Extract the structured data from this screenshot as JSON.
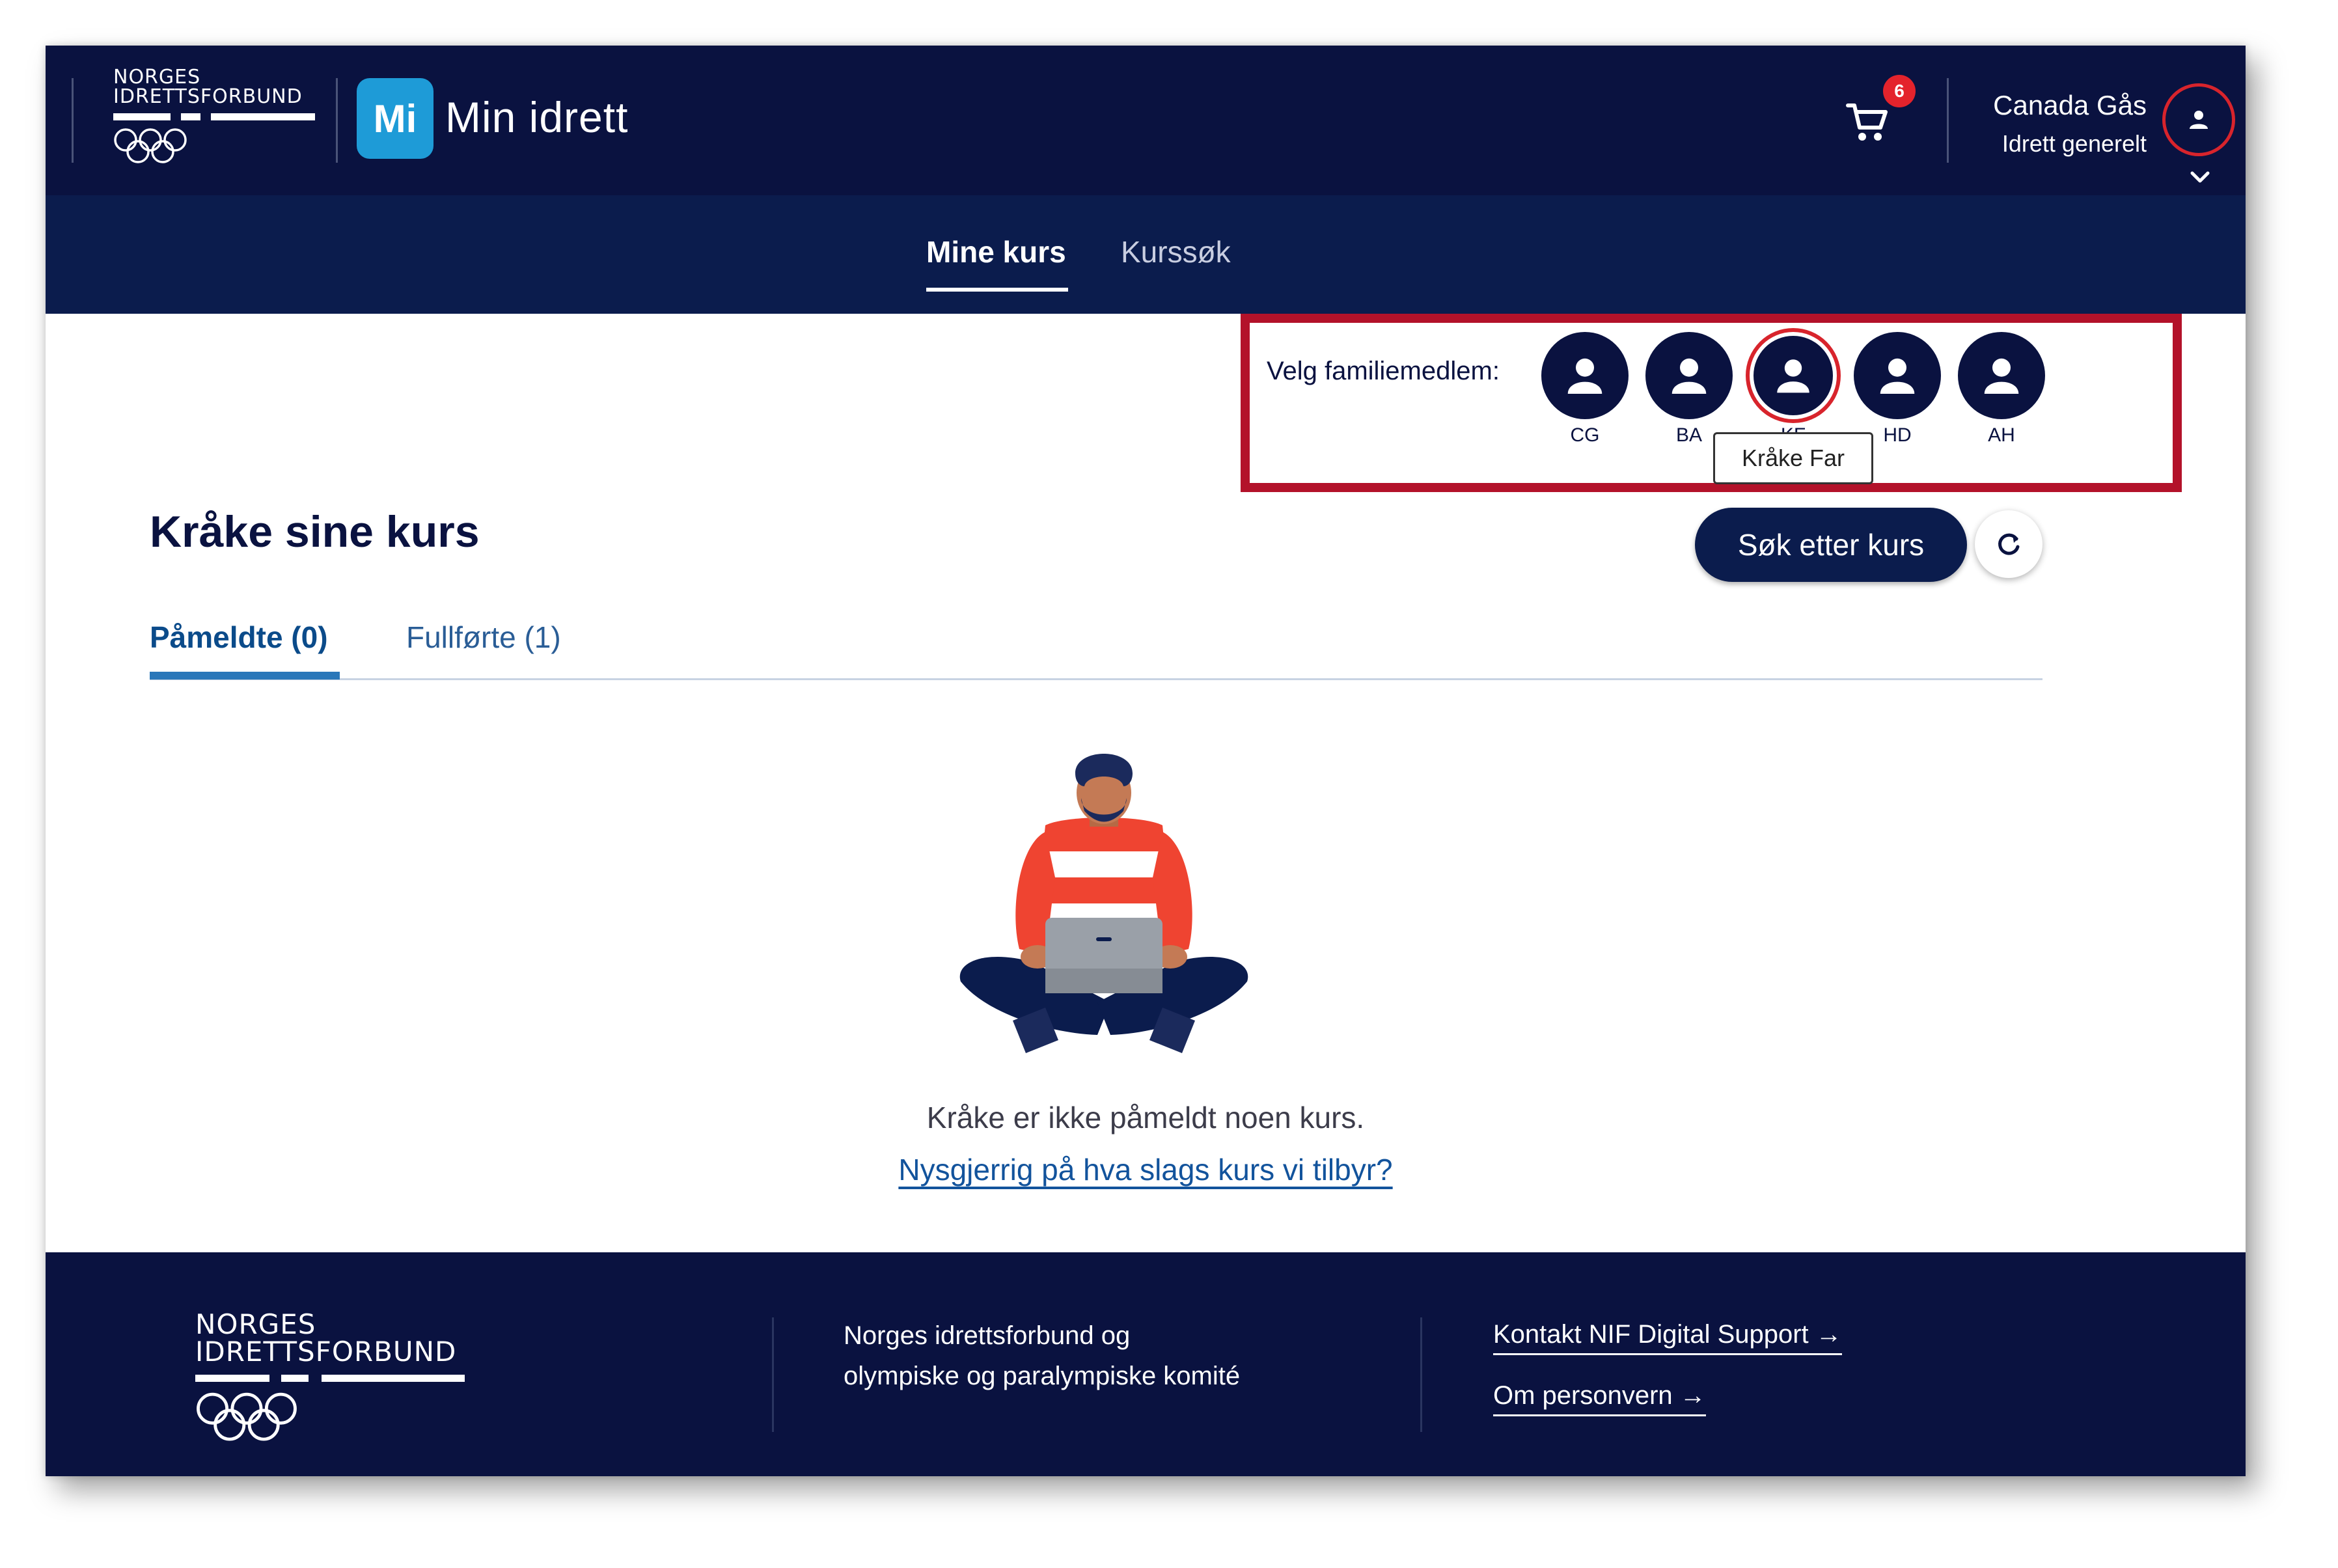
{
  "header": {
    "org_line1": "NORGES",
    "org_line2": "IDRETTSFORBUND",
    "app_badge": "Mi",
    "app_title": "Min idrett",
    "cart_count": "6",
    "user_name": "Canada Gås",
    "user_org": "Idrett generelt",
    "icons": [
      "olympic-rings-icon",
      "cart-icon",
      "user-icon",
      "chevron-down-icon"
    ]
  },
  "nav": {
    "tabs": [
      {
        "label": "Mine kurs",
        "active": true
      },
      {
        "label": "Kurssøk",
        "active": false
      }
    ]
  },
  "family": {
    "label": "Velg familiemedlem:",
    "members": [
      {
        "code": "CG",
        "selected": false
      },
      {
        "code": "BA",
        "selected": false
      },
      {
        "code": "KF",
        "selected": true
      },
      {
        "code": "HD",
        "selected": false
      },
      {
        "code": "AH",
        "selected": false
      }
    ],
    "tooltip": "Kråke Far"
  },
  "main": {
    "title": "Kråke sine kurs",
    "search_button": "Søk etter kurs",
    "refresh_icon": "refresh-icon",
    "tabs": [
      {
        "label": "Påmeldte (0)",
        "active": true
      },
      {
        "label": "Fullførte (1)",
        "active": false
      }
    ],
    "empty_text": "Kråke er ikke påmeldt noen kurs.",
    "empty_link": "Nysgjerrig på hva slags kurs vi tilbyr?"
  },
  "footer": {
    "org_line1": "NORGES",
    "org_line2": "IDRETTSFORBUND",
    "description_line1": "Norges idrettsforbund og",
    "description_line2": "olympiske og paralympiske komité",
    "links": [
      "Kontakt NIF Digital Support →",
      "Om personvern →"
    ]
  },
  "colors": {
    "header_bg": "#0a1240",
    "nav_bg": "#0b1c4d",
    "accent_blue": "#1e9bd7",
    "highlight_red": "#b3122a",
    "badge_red": "#e4232c",
    "link_blue": "#12539c"
  }
}
